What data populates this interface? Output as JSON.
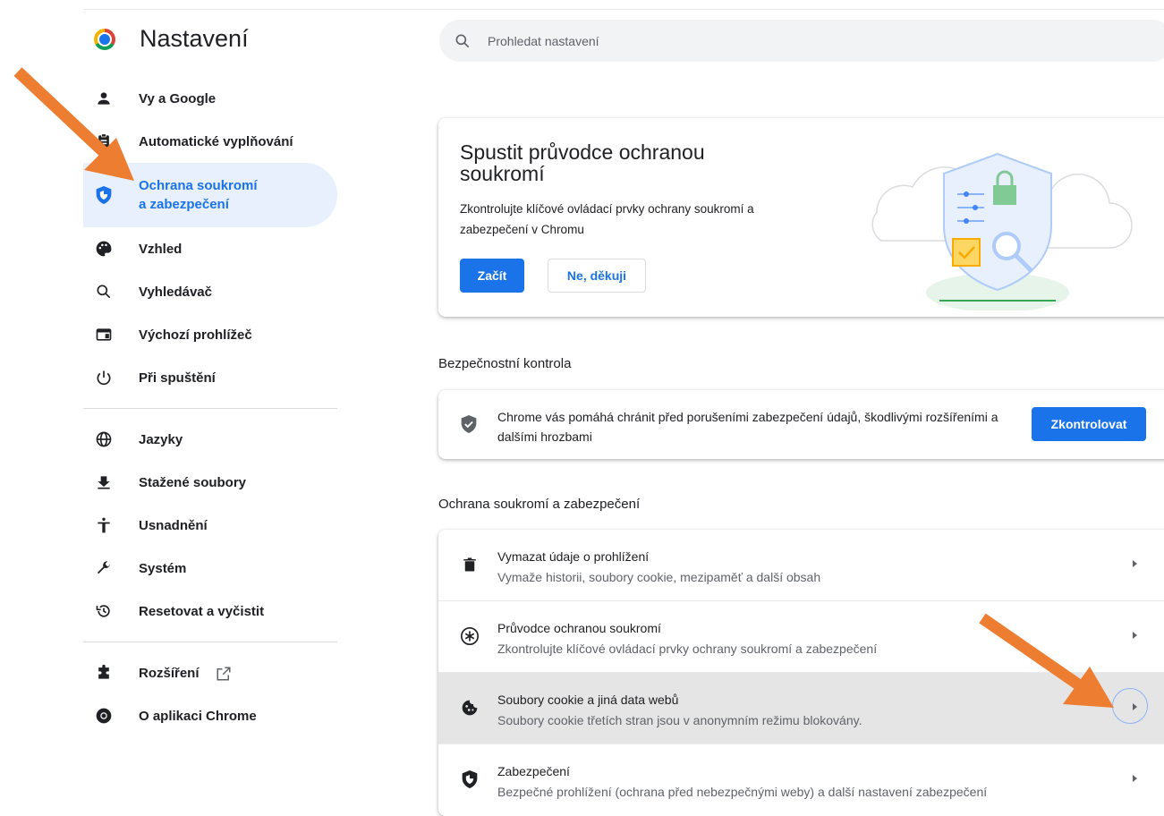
{
  "header": {
    "app_title": "Nastavení",
    "search_placeholder": "Prohledat nastavení"
  },
  "sidebar": {
    "items": [
      {
        "label": "Vy a Google",
        "icon": "person-icon"
      },
      {
        "label": "Automatické vyplňování",
        "icon": "clipboard-icon"
      },
      {
        "label_line1": "Ochrana soukromí",
        "label_line2": "a zabezpečení",
        "icon": "shield-icon",
        "active": true
      },
      {
        "label": "Vzhled",
        "icon": "palette-icon"
      },
      {
        "label": "Vyhledávač",
        "icon": "search-icon"
      },
      {
        "label": "Výchozí prohlížeč",
        "icon": "browser-window-icon"
      },
      {
        "label": "Při spuštění",
        "icon": "power-icon"
      },
      {
        "label": "Jazyky",
        "icon": "globe-icon"
      },
      {
        "label": "Stažené soubory",
        "icon": "download-icon"
      },
      {
        "label": "Usnadnění",
        "icon": "accessibility-icon"
      },
      {
        "label": "Systém",
        "icon": "wrench-icon"
      },
      {
        "label": "Resetovat a vyčistit",
        "icon": "history-icon"
      },
      {
        "label": "Rozšíření",
        "icon": "puzzle-icon"
      },
      {
        "label": "O aplikaci Chrome",
        "icon": "chrome-icon"
      }
    ]
  },
  "promo": {
    "title": "Spustit průvodce ochranou soukromí",
    "description": "Zkontrolujte klíčové ovládací prvky ochrany soukromí a zabezpečení v Chromu",
    "start_label": "Začít",
    "decline_label": "Ne, děkuji"
  },
  "safety_check": {
    "section_title": "Bezpečnostní kontrola",
    "text": "Chrome vás pomáhá chránit před porušeními zabezpečení údajů, škodlivými rozšířeními a dalšími hrozbami",
    "button_label": "Zkontrolovat"
  },
  "privacy": {
    "section_title": "Ochrana soukromí a zabezpečení",
    "rows": [
      {
        "title": "Vymazat údaje o prohlížení",
        "subtitle": "Vymaže historii, soubory cookie, mezipaměť a další obsah",
        "icon": "trash-icon"
      },
      {
        "title": "Průvodce ochranou soukromí",
        "subtitle": "Zkontrolujte klíčové ovládací prvky ochrany soukromí a zabezpečení",
        "icon": "privacy-guide-icon"
      },
      {
        "title": "Soubory cookie a jiná data webů",
        "subtitle": "Soubory cookie třetích stran jsou v anonymním režimu blokovány.",
        "icon": "cookie-icon",
        "highlighted": true
      },
      {
        "title": "Zabezpečení",
        "subtitle": "Bezpečné prohlížení (ochrana před nebezpečnými weby) a další nastavení zabezpečení",
        "icon": "security-shield-icon"
      }
    ]
  },
  "colors": {
    "accent": "#1a73e8",
    "active_nav_bg": "#e8f0fe",
    "annotation_arrow": "#ed7d31",
    "highlight_row_bg": "#e5e5e5"
  }
}
